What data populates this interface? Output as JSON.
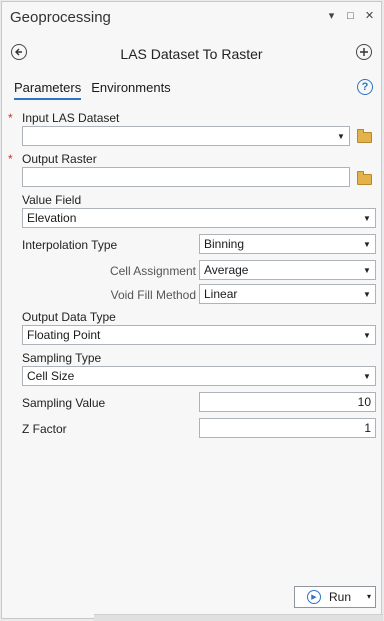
{
  "window": {
    "title": "Geoprocessing",
    "controls": [
      "▾",
      "□",
      "✕"
    ]
  },
  "toolbar": {
    "back_icon": "back-arrow-icon",
    "title": "LAS Dataset To Raster",
    "add_icon": "plus-icon"
  },
  "tabs": [
    {
      "label": "Parameters",
      "active": true
    },
    {
      "label": "Environments",
      "active": false
    }
  ],
  "help_icon": "?",
  "params": {
    "input_las": {
      "label": "Input LAS Dataset",
      "value": "",
      "required": true
    },
    "output_raster": {
      "label": "Output Raster",
      "value": "",
      "required": true
    },
    "value_field": {
      "label": "Value Field",
      "value": "Elevation"
    },
    "interpolation_type": {
      "label": "Interpolation Type",
      "value": "Binning"
    },
    "cell_assignment": {
      "label": "Cell Assignment",
      "value": "Average"
    },
    "void_fill": {
      "label": "Void Fill Method",
      "value": "Linear"
    },
    "output_data_type": {
      "label": "Output Data Type",
      "value": "Floating Point"
    },
    "sampling_type": {
      "label": "Sampling Type",
      "value": "Cell Size"
    },
    "sampling_value": {
      "label": "Sampling Value",
      "value": "10"
    },
    "z_factor": {
      "label": "Z Factor",
      "value": "1"
    }
  },
  "required_marker": "*",
  "caret": "▼",
  "run": {
    "label": "Run",
    "caret": "▾"
  },
  "colors": {
    "accent": "#2e73c7",
    "required": "#c83232"
  }
}
